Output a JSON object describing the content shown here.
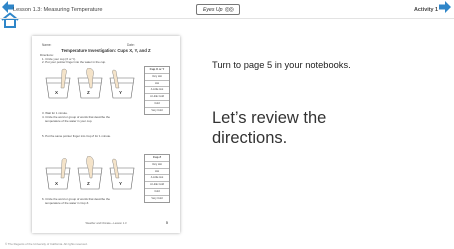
{
  "header": {
    "lesson_title": "Lesson 1.3: Measuring Temperature",
    "eyes_up_label": "Eyes Up",
    "activity_label": "Activity 1",
    "accent_color": "#2f86c9"
  },
  "worksheet": {
    "name_label": "Name:",
    "date_label": "Date:",
    "title": "Temperature Investigation: Cups X, Y, and Z",
    "directions_label": "Directions:",
    "step1": "1. Circle your cup (X or Y).",
    "step2": "2. Put your pointer finger into the water in the cup.",
    "step3": "3. Wait for 1 minute.",
    "step4a": "4. Circle the word or group of words that describe the",
    "step4b": "temperature of the water in your cup.",
    "step5": "5. Put the same pointer finger into Cup Z for 1 minute.",
    "step6a": "6. Circle the word or group of words that describe the",
    "step6b": "temperature of the water in Cup Z.",
    "box1": {
      "header": "Cup X or Y",
      "options": [
        "Very Hot",
        "Hot",
        "A Little Hot",
        "A Little Cold",
        "Cold",
        "Very Cold"
      ]
    },
    "box2": {
      "header": "Cup Z",
      "options": [
        "Very Hot",
        "Hot",
        "A Little Hot",
        "A Little Cold",
        "Cold",
        "Very Cold"
      ]
    },
    "cups_top": [
      "X",
      "Z",
      "Y"
    ],
    "cups_bottom": [
      "X",
      "Z",
      "Y"
    ],
    "footer": "Weather and Climate—Lesson 1.3",
    "page_number": "5"
  },
  "main": {
    "instruction": "Turn to page 5 in your notebooks.",
    "review_text": "Let’s review the directions."
  },
  "footer": {
    "copyright": "© The Regents of the University of California. All rights reserved."
  }
}
